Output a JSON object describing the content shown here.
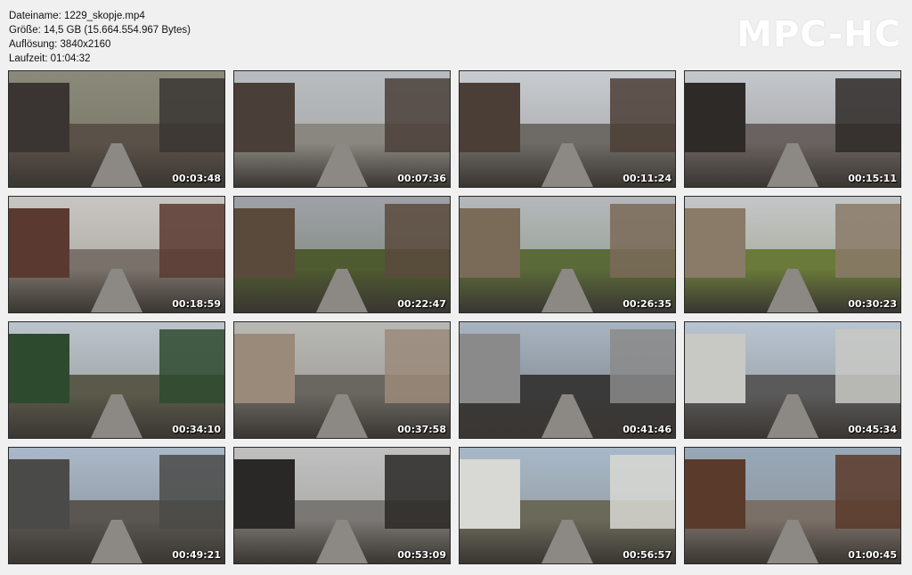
{
  "info": {
    "filename": "Dateiname: 1229_skopje.mp4",
    "size": "Größe: 14,5 GB (15.664.554.967 Bytes)",
    "resolution": "Auflösung: 3840x2160",
    "duration": "Laufzeit: 01:04:32"
  },
  "logo": "MPC-HC",
  "thumbnails": [
    {
      "time": "00:03:48",
      "sky": "#8a8a7a",
      "ground": "#5a5248",
      "bld": "#3a3532"
    },
    {
      "time": "00:07:36",
      "sky": "#b8bcc0",
      "ground": "#8a8680",
      "bld": "#4a3f38"
    },
    {
      "time": "00:11:24",
      "sky": "#c8ccd0",
      "ground": "#6e6a66",
      "bld": "#4b3e36"
    },
    {
      "time": "00:15:11",
      "sky": "#c4c8cc",
      "ground": "#6a6260",
      "bld": "#2e2a28"
    },
    {
      "time": "00:18:59",
      "sky": "#c8c6c2",
      "ground": "#7a726a",
      "bld": "#5a3a30"
    },
    {
      "time": "00:22:47",
      "sky": "#9ea2a8",
      "ground": "#4e5a30",
      "bld": "#5a4a3c"
    },
    {
      "time": "00:26:35",
      "sky": "#b4b8bc",
      "ground": "#5a6a38",
      "bld": "#7a6a58"
    },
    {
      "time": "00:30:23",
      "sky": "#c4c6c8",
      "ground": "#6a7a3a",
      "bld": "#8a7a68"
    },
    {
      "time": "00:34:10",
      "sky": "#bcc4cc",
      "ground": "#5a5a4a",
      "bld": "#2e4a2e"
    },
    {
      "time": "00:37:58",
      "sky": "#b8b8b4",
      "ground": "#6a6660",
      "bld": "#9a8a7a"
    },
    {
      "time": "00:41:46",
      "sky": "#a8b4c0",
      "ground": "#3a3a3a",
      "bld": "#8a8a8a"
    },
    {
      "time": "00:45:34",
      "sky": "#b8c4d0",
      "ground": "#5a5a5a",
      "bld": "#c8c8c4"
    },
    {
      "time": "00:49:21",
      "sky": "#aab8c8",
      "ground": "#5a5652",
      "bld": "#4a4a48"
    },
    {
      "time": "00:53:09",
      "sky": "#c0c0c0",
      "ground": "#7a7874",
      "bld": "#2a2826"
    },
    {
      "time": "00:56:57",
      "sky": "#a8b8c8",
      "ground": "#6a6a5a",
      "bld": "#d8d8d4"
    },
    {
      "time": "01:00:45",
      "sky": "#98a8b8",
      "ground": "#7a7068",
      "bld": "#5a3a2a"
    }
  ]
}
